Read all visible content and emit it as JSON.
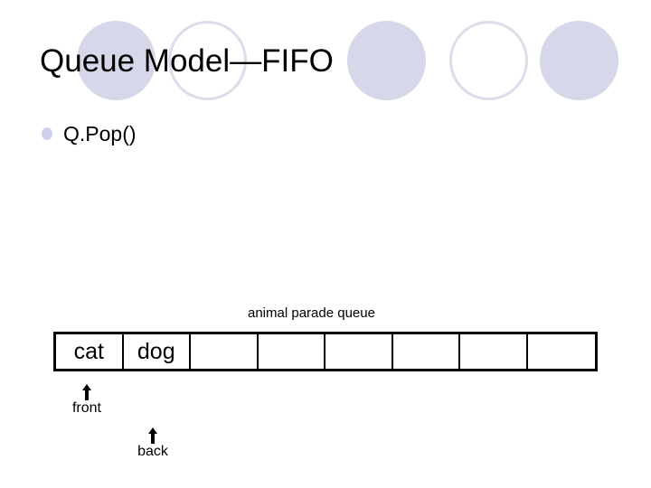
{
  "slide": {
    "title": "Queue Model—FIFO",
    "bullets": [
      {
        "text": "Q.Pop()"
      }
    ],
    "decorations": {
      "circles": [
        "filled",
        "outline",
        "filled",
        "outline",
        "filled"
      ],
      "filled_color": "#d7d7ea",
      "outline_color": "#dcdcea"
    }
  },
  "queue": {
    "caption": "animal parade queue",
    "cells": [
      "cat",
      "dog",
      "",
      "",
      "",
      "",
      "",
      ""
    ],
    "front_label": "front",
    "back_label": "back",
    "front_index": 0,
    "back_index": 1
  }
}
